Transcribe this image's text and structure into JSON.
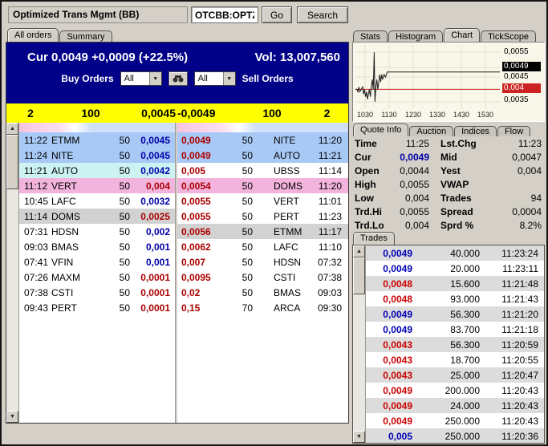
{
  "colors": {
    "navy": "#000088",
    "yellow": "#ffff00",
    "buy_price": "#0000a8",
    "sell_price": "#aa0000",
    "row_blue": "#a8c9f5",
    "row_cyan": "#ccf2f2",
    "row_pink": "#f2b3dd",
    "row_gray": "#d2d2d2",
    "trade_up": "#0000b4",
    "trade_down": "#cc0000",
    "marker_black": "#000000",
    "marker_red": "#cc2222"
  },
  "topbar": {
    "title": "Optimized Trans Mgmt (BB)",
    "ticker_value": "OTCBB:OPTZ",
    "go_label": "Go",
    "search_label": "Search"
  },
  "book_tabs": {
    "all_orders": "All orders",
    "summary": "Summary"
  },
  "chart_tabs": {
    "stats": "Stats",
    "histogram": "Histogram",
    "chart": "Chart",
    "tickscope": "TickScope"
  },
  "header": {
    "cur_line": "Cur 0,0049 +0,0009 (+22.5%)",
    "vol_line": "Vol: 13,007,560",
    "buy_orders_label": "Buy Orders",
    "sell_orders_label": "Sell Orders",
    "buy_filter_value": "All",
    "sell_filter_value": "All"
  },
  "level1": {
    "bid_count": "2",
    "bid_size": "100",
    "bid_price": "0,0045",
    "ask_price": "-0,0049",
    "ask_size": "100",
    "ask_count": "2"
  },
  "book": {
    "bids": [
      {
        "time": "11:22",
        "name": "ETMM",
        "qty": "50",
        "price": "0,0045",
        "bg": "blue",
        "tone": "buy"
      },
      {
        "time": "11:24",
        "name": "NITE",
        "qty": "50",
        "price": "0,0045",
        "bg": "blue",
        "tone": "buy"
      },
      {
        "time": "11:21",
        "name": "AUTO",
        "qty": "50",
        "price": "0,0042",
        "bg": "cyan",
        "tone": "buy"
      },
      {
        "time": "11:12",
        "name": "VERT",
        "qty": "50",
        "price": "0,004",
        "bg": "pink",
        "tone": "sell"
      },
      {
        "time": "10:45",
        "name": "LAFC",
        "qty": "50",
        "price": "0,0032",
        "bg": "white",
        "tone": "buy"
      },
      {
        "time": "11:14",
        "name": "DOMS",
        "qty": "50",
        "price": "0,0025",
        "bg": "gray",
        "tone": "sell"
      },
      {
        "time": "07:31",
        "name": "HDSN",
        "qty": "50",
        "price": "0,002",
        "bg": "white",
        "tone": "buy"
      },
      {
        "time": "09:03",
        "name": "BMAS",
        "qty": "50",
        "price": "0,001",
        "bg": "white",
        "tone": "buy"
      },
      {
        "time": "07:41",
        "name": "VFIN",
        "qty": "50",
        "price": "0,001",
        "bg": "white",
        "tone": "buy"
      },
      {
        "time": "07:26",
        "name": "MAXM",
        "qty": "50",
        "price": "0,0001",
        "bg": "white",
        "tone": "sell"
      },
      {
        "time": "07:38",
        "name": "CSTI",
        "qty": "50",
        "price": "0,0001",
        "bg": "white",
        "tone": "sell"
      },
      {
        "time": "09:43",
        "name": "PERT",
        "qty": "50",
        "price": "0,0001",
        "bg": "white",
        "tone": "sell"
      }
    ],
    "asks": [
      {
        "price": "0,0049",
        "qty": "50",
        "name": "NITE",
        "time": "11:20",
        "bg": "blue"
      },
      {
        "price": "0,0049",
        "qty": "50",
        "name": "AUTO",
        "time": "11:21",
        "bg": "blue"
      },
      {
        "price": "0,005",
        "qty": "50",
        "name": "UBSS",
        "time": "11:14",
        "bg": "white"
      },
      {
        "price": "0,0054",
        "qty": "50",
        "name": "DOMS",
        "time": "11:20",
        "bg": "pink"
      },
      {
        "price": "0,0055",
        "qty": "50",
        "name": "VERT",
        "time": "11:01",
        "bg": "white"
      },
      {
        "price": "0,0055",
        "qty": "50",
        "name": "PERT",
        "time": "11:23",
        "bg": "white"
      },
      {
        "price": "0,0056",
        "qty": "50",
        "name": "ETMM",
        "time": "11:17",
        "bg": "gray"
      },
      {
        "price": "0,0062",
        "qty": "50",
        "name": "LAFC",
        "time": "11:10",
        "bg": "white"
      },
      {
        "price": "0,007",
        "qty": "50",
        "name": "HDSN",
        "time": "07:32",
        "bg": "white"
      },
      {
        "price": "0,0095",
        "qty": "50",
        "name": "CSTI",
        "time": "07:38",
        "bg": "white"
      },
      {
        "price": "0,02",
        "qty": "50",
        "name": "BMAS",
        "time": "09:03",
        "bg": "white"
      },
      {
        "price": "0,15",
        "qty": "70",
        "name": "ARCA",
        "time": "09:30",
        "bg": "white"
      }
    ]
  },
  "chart": {
    "type": "line",
    "y_axis": [
      {
        "text": "0,0055",
        "style": "plain"
      },
      {
        "text": "0,0049",
        "style": "current"
      },
      {
        "text": "0,0045",
        "style": "plain"
      },
      {
        "text": "0,004",
        "style": "ref"
      },
      {
        "text": "0,0035",
        "style": "plain"
      }
    ],
    "x_axis": [
      "1030",
      "1130",
      "1230",
      "1330",
      "1430",
      "1530"
    ],
    "x_range": [
      1000,
      1600
    ],
    "y_range": [
      0.0032,
      0.0058
    ],
    "ref_price": 0.004,
    "series": [
      [
        1000,
        0.004
      ],
      [
        1006,
        0.004
      ],
      [
        1010,
        0.0039
      ],
      [
        1014,
        0.0041
      ],
      [
        1018,
        0.0039
      ],
      [
        1024,
        0.004
      ],
      [
        1030,
        0.0041
      ],
      [
        1034,
        0.0038
      ],
      [
        1038,
        0.004
      ],
      [
        1042,
        0.0037
      ],
      [
        1046,
        0.0039
      ],
      [
        1050,
        0.0036
      ],
      [
        1054,
        0.0038
      ],
      [
        1058,
        0.004
      ],
      [
        1062,
        0.0037
      ],
      [
        1066,
        0.0041
      ],
      [
        1070,
        0.0044
      ],
      [
        1074,
        0.004
      ],
      [
        1078,
        0.0055
      ],
      [
        1081,
        0.0035
      ],
      [
        1085,
        0.0041
      ],
      [
        1089,
        0.0044
      ],
      [
        1093,
        0.004
      ],
      [
        1097,
        0.0043
      ],
      [
        1101,
        0.0046
      ],
      [
        1105,
        0.0043
      ],
      [
        1109,
        0.0046
      ],
      [
        1113,
        0.0044
      ],
      [
        1119,
        0.0046
      ],
      [
        1125,
        0.0045
      ],
      [
        1132,
        0.0047
      ],
      [
        1600,
        0.0047
      ]
    ]
  },
  "quote_tabs": {
    "quote_info": "Quote Info",
    "auction": "Auction",
    "indices": "Indices",
    "flow": "Flow"
  },
  "quote_info": {
    "rows": [
      {
        "l1": "Time",
        "v1": "11:25",
        "l2": "Lst.Chg",
        "v2": "11:23"
      },
      {
        "l1": "Cur",
        "v1": "0,0049",
        "l2": "Mid",
        "v2": "0,0047"
      },
      {
        "l1": "Open",
        "v1": "0,0044",
        "l2": "Yest",
        "v2": "0,004"
      },
      {
        "l1": "High",
        "v1": "0,0055",
        "l2": "VWAP",
        "v2": ""
      },
      {
        "l1": "Low",
        "v1": "0,004",
        "l2": "Trades",
        "v2": "94"
      },
      {
        "l1": "Trd.Hi",
        "v1": "0,0055",
        "l2": "Spread",
        "v2": "0,0004"
      },
      {
        "l1": "Trd.Lo",
        "v1": "0,004",
        "l2": "Sprd %",
        "v2": "8.2%"
      }
    ]
  },
  "trades": {
    "tab_label": "Trades",
    "rows": [
      {
        "price": "0,0049",
        "size": "40.000",
        "time": "11:23:24",
        "dir": "up"
      },
      {
        "price": "0,0049",
        "size": "20.000",
        "time": "11:23:11",
        "dir": "up"
      },
      {
        "price": "0,0048",
        "size": "15.600",
        "time": "11:21:48",
        "dir": "down"
      },
      {
        "price": "0,0048",
        "size": "93.000",
        "time": "11:21:43",
        "dir": "down"
      },
      {
        "price": "0,0049",
        "size": "56.300",
        "time": "11:21:20",
        "dir": "up"
      },
      {
        "price": "0,0049",
        "size": "83.700",
        "time": "11:21:18",
        "dir": "up"
      },
      {
        "price": "0,0043",
        "size": "56.300",
        "time": "11:20:59",
        "dir": "down"
      },
      {
        "price": "0,0043",
        "size": "18.700",
        "time": "11:20:55",
        "dir": "down"
      },
      {
        "price": "0,0043",
        "size": "25.000",
        "time": "11:20:47",
        "dir": "down"
      },
      {
        "price": "0,0049",
        "size": "200.000",
        "time": "11:20:43",
        "dir": "down"
      },
      {
        "price": "0,0049",
        "size": "24.000",
        "time": "11:20:43",
        "dir": "down"
      },
      {
        "price": "0,0049",
        "size": "250.000",
        "time": "11:20:43",
        "dir": "down"
      },
      {
        "price": "0,005",
        "size": "250.000",
        "time": "11:20:36",
        "dir": "up"
      }
    ]
  }
}
